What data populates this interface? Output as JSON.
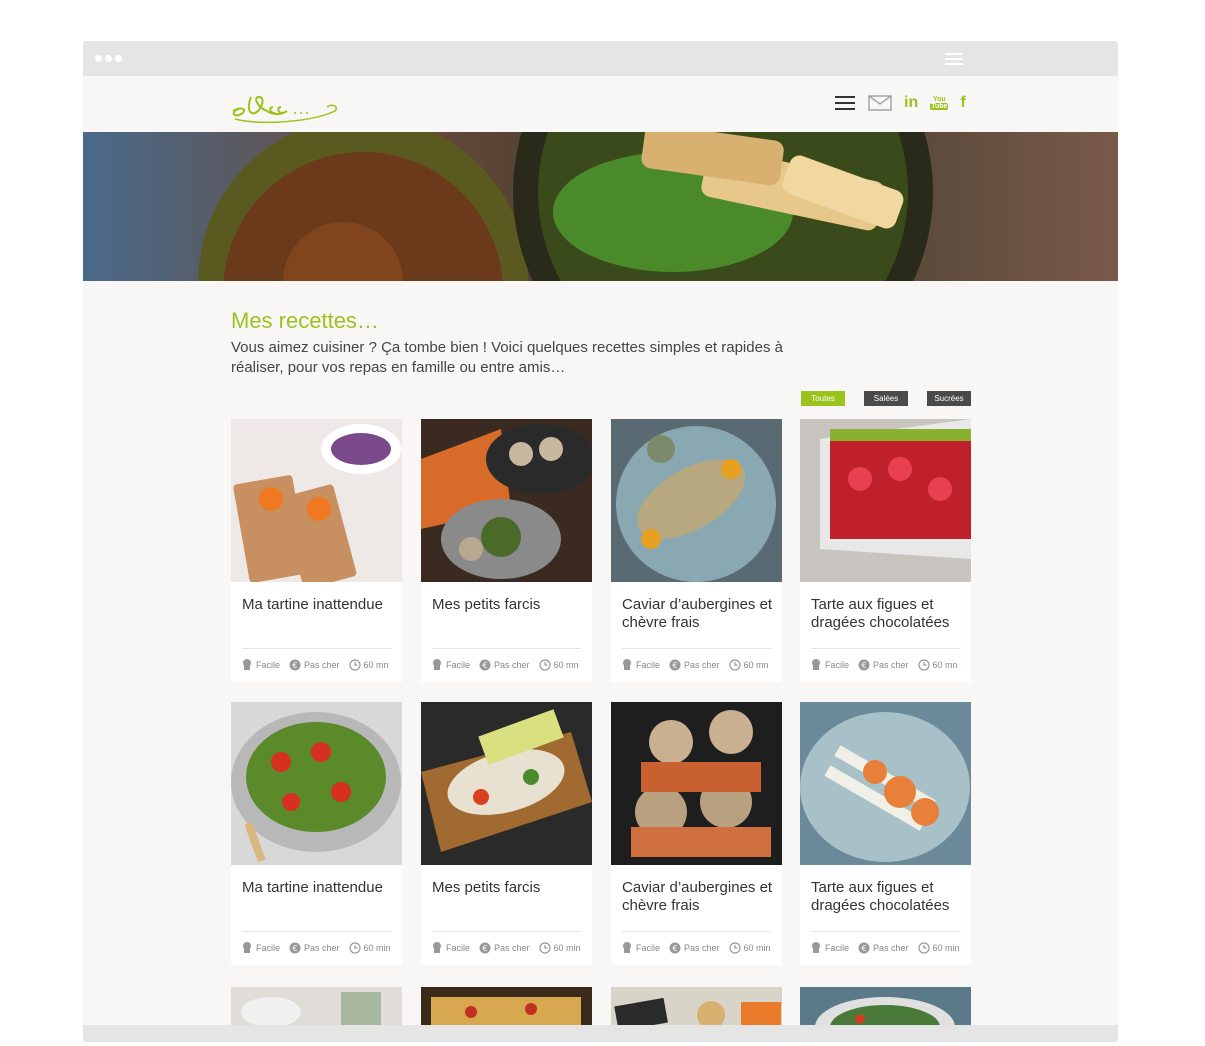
{
  "header": {
    "logo_text": "eRcc"
  },
  "nav": {
    "icons": [
      "menu-icon",
      "mail-icon",
      "linkedin-icon",
      "youtube-icon",
      "facebook-icon"
    ],
    "linkedin": "in",
    "youtube_top": "You",
    "youtube_bottom": "Tube",
    "facebook": "f"
  },
  "page": {
    "title": "Mes recettes…",
    "intro": "Vous aimez cuisiner ? Ça tombe bien ! Voici quelques recettes simples et rapides à réaliser, pour vos repas en famille ou entre amis…"
  },
  "filters": [
    {
      "label": "Toutes",
      "active": true
    },
    {
      "label": "Salées",
      "active": false
    },
    {
      "label": "Sucrées",
      "active": false
    }
  ],
  "recipes": [
    {
      "title": "Ma tartine inattendue",
      "difficulty": "Facile",
      "price": "Pas cher",
      "time": "60 mn"
    },
    {
      "title": "Mes petits farcis",
      "difficulty": "Facile",
      "price": "Pas cher",
      "time": "60 mn"
    },
    {
      "title": "Caviar d’aubergines et chèvre frais",
      "difficulty": "Facile",
      "price": "Pas cher",
      "time": "60 mn"
    },
    {
      "title": "Tarte aux figues et dragées chocolatées",
      "difficulty": "Facile",
      "price": "Pas cher",
      "time": "60 mn"
    },
    {
      "title": "Ma tartine inattendue",
      "difficulty": "Facile",
      "price": "Pas cher",
      "time": "60 min"
    },
    {
      "title": "Mes petits farcis",
      "difficulty": "Facile",
      "price": "Pas cher",
      "time": "60 min"
    },
    {
      "title": "Caviar d’aubergines et chèvre frais",
      "difficulty": "Facile",
      "price": "Pas cher",
      "time": "60 min"
    },
    {
      "title": "Tarte aux figues et dragées chocolatées",
      "difficulty": "Facile",
      "price": "Pas cher",
      "time": "60 min"
    }
  ],
  "colors": {
    "accent": "#9cc21e",
    "text": "#333333",
    "filter_inactive": "#4a4a4a"
  }
}
